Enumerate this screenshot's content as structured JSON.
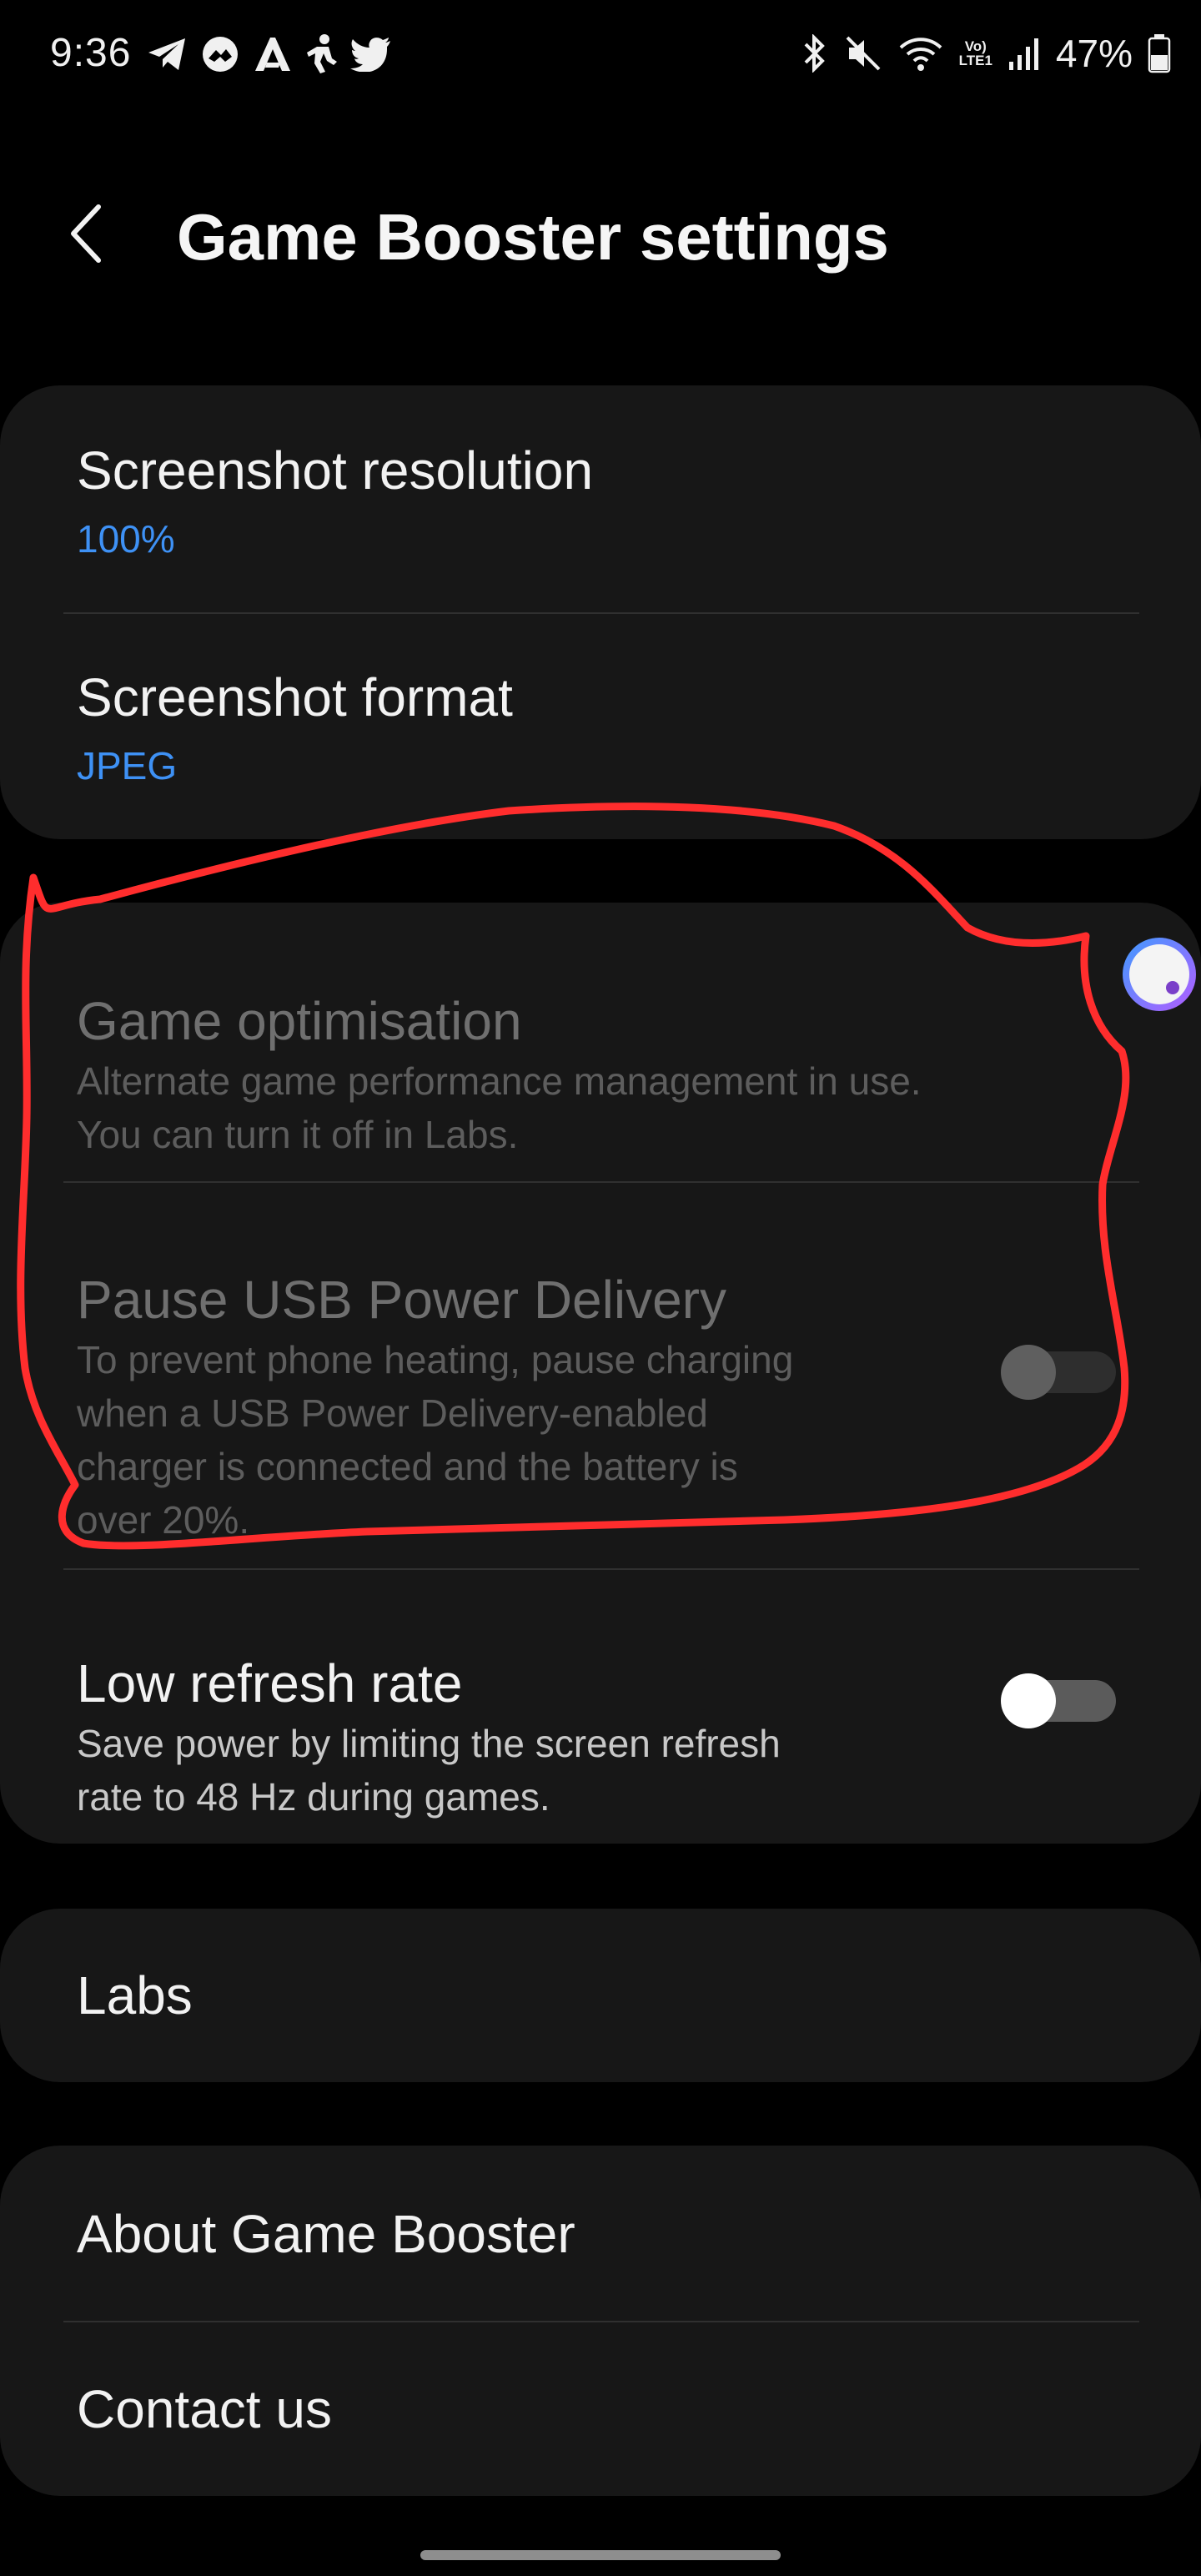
{
  "status_bar": {
    "time": "9:36",
    "battery": "47%",
    "network_badge_top": "Vo)",
    "network_badge_bottom": "LTE1",
    "left_icons": [
      "telegram-icon",
      "messenger-icon",
      "arc-icon",
      "runner-icon",
      "twitter-icon"
    ],
    "right_icons": [
      "bluetooth-icon",
      "mute-icon",
      "wifi-icon",
      "volte-icon",
      "signal-icon",
      "battery-icon"
    ]
  },
  "header": {
    "title": "Game Booster settings",
    "back_icon": "chevron-left-icon"
  },
  "screenshot_card": {
    "resolution_title": "Screenshot resolution",
    "resolution_value": "100%",
    "format_title": "Screenshot format",
    "format_value": "JPEG"
  },
  "performance_card": {
    "optimisation_title": "Game optimisation",
    "optimisation_desc": "Alternate game performance management in use.\nYou can turn it off in Labs.",
    "usb_title": "Pause USB Power Delivery",
    "usb_desc": "To prevent phone heating, pause charging\nwhen a USB Power Delivery-enabled\ncharger is connected and the battery is\nover 20%.",
    "usb_enabled": false,
    "refresh_title": "Low refresh rate",
    "refresh_desc": "Save power by limiting the screen refresh\nrate to 48 Hz during games.",
    "refresh_enabled": false
  },
  "labs_card": {
    "labs_title": "Labs"
  },
  "about_card": {
    "about_title": "About Game Booster",
    "contact_title": "Contact us"
  },
  "colors": {
    "background": "#000000",
    "card": "#171717",
    "accent_blue": "#3e91f5",
    "annotation_red": "#ff2d2d"
  }
}
